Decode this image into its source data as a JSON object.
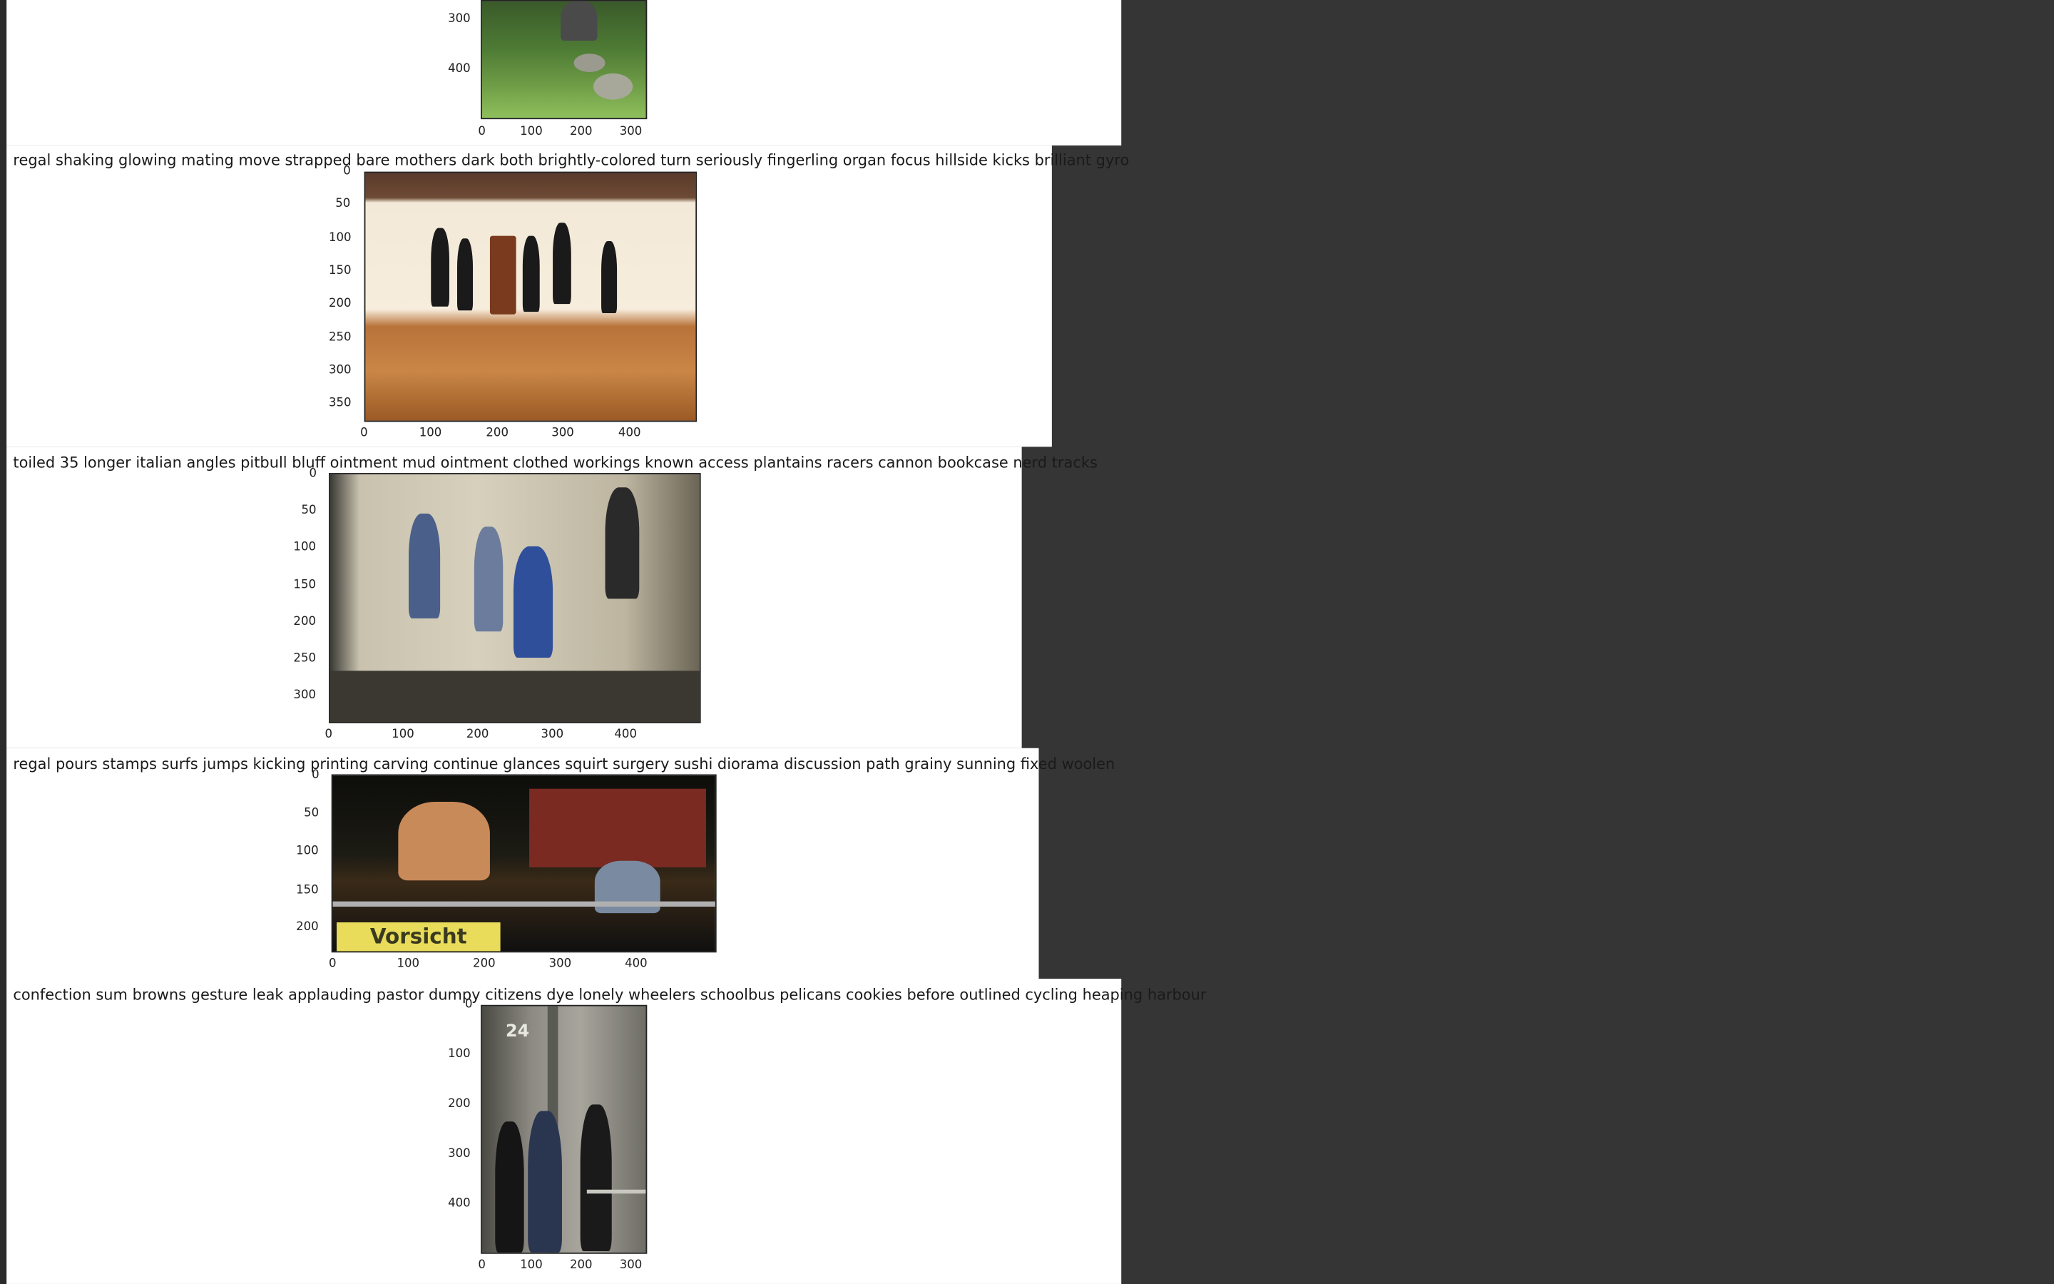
{
  "captions": [
    "regal shaking glowing mating move strapped bare mothers dark both brightly-colored turn seriously fingerling organ focus hillside kicks brilliant gyro",
    "toiled 35 longer italian angles pitbull bluff ointment mud ointment clothed workings known access plantains racers cannon bookcase nerd tracks",
    "regal pours stamps surfs jumps kicking printing carving continue glances squirt surgery sushi diorama discussion path grainy sunning fixed woolen",
    "confection sum browns gesture leak applauding pastor dumpy citizens dye lonely wheelers schoolbus pelicans cookies before outlined cycling heaping harbour"
  ],
  "plots": [
    {
      "image": "garden-path-photo",
      "x_ticks": [
        "0",
        "100",
        "200",
        "300"
      ],
      "y_ticks": [
        "300",
        "400"
      ]
    },
    {
      "image": "dance-studio-photo",
      "x_ticks": [
        "0",
        "100",
        "200",
        "300",
        "400"
      ],
      "y_ticks": [
        "0",
        "50",
        "100",
        "150",
        "200",
        "250",
        "300",
        "350"
      ]
    },
    {
      "image": "jumping-down-stairs-photo",
      "x_ticks": [
        "0",
        "100",
        "200",
        "300",
        "400"
      ],
      "y_ticks": [
        "0",
        "50",
        "100",
        "150",
        "200",
        "250",
        "300"
      ]
    },
    {
      "image": "night-jump-vorsicht-photo",
      "x_ticks": [
        "0",
        "100",
        "200",
        "300",
        "400"
      ],
      "y_ticks": [
        "0",
        "50",
        "100",
        "150",
        "200"
      ],
      "sign_text": "Vorsicht"
    },
    {
      "image": "street-pedestrians-photo",
      "x_ticks": [
        "0",
        "100",
        "200",
        "300"
      ],
      "y_ticks": [
        "0",
        "100",
        "200",
        "300",
        "400"
      ],
      "sign_text": "24"
    }
  ]
}
